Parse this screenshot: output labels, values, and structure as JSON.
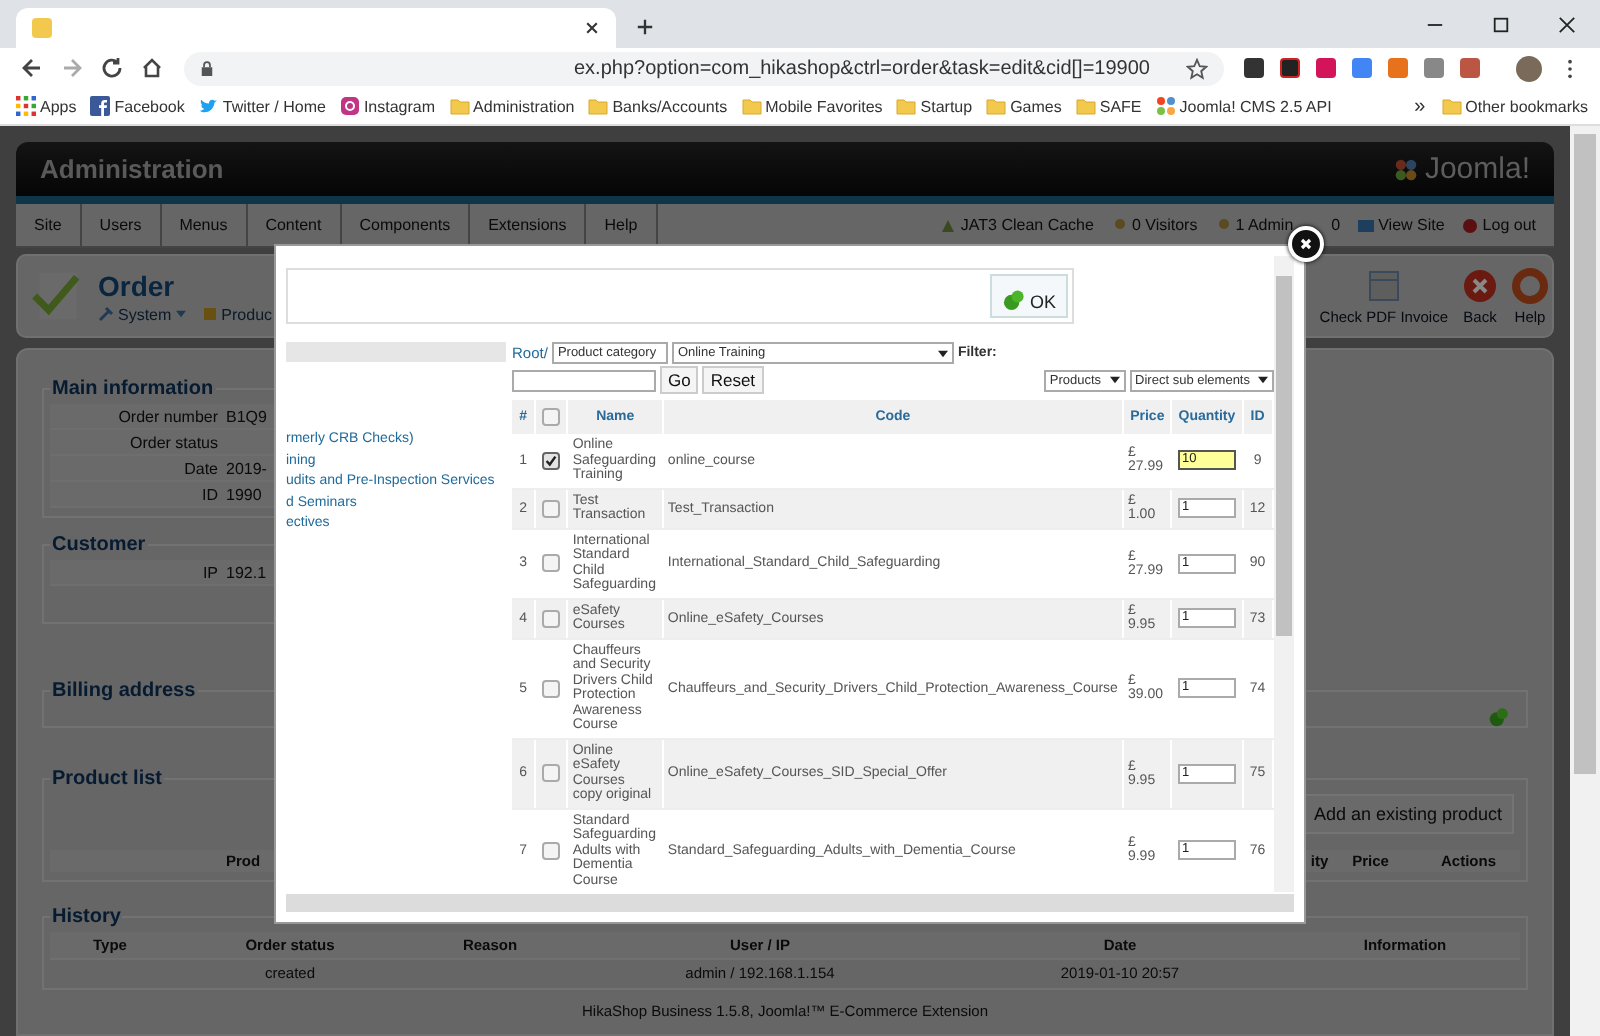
{
  "browser": {
    "url": "ex.php?option=com_hikashop&ctrl=order&task=edit&cid[]=19900",
    "bookmarks": [
      {
        "label": "Apps",
        "kind": "apps"
      },
      {
        "label": "Facebook",
        "kind": "facebook"
      },
      {
        "label": "Twitter / Home",
        "kind": "twitter"
      },
      {
        "label": "Instagram",
        "kind": "instagram"
      },
      {
        "label": "Administration",
        "kind": "folder"
      },
      {
        "label": "Banks/Accounts",
        "kind": "folder"
      },
      {
        "label": "Mobile Favorites",
        "kind": "folder"
      },
      {
        "label": "Startup",
        "kind": "folder"
      },
      {
        "label": "Games",
        "kind": "folder"
      },
      {
        "label": "SAFE",
        "kind": "folder"
      },
      {
        "label": "Joomla! CMS 2.5 API",
        "kind": "joomla"
      }
    ],
    "bookmarks_overflow": "»",
    "other_bookmarks": "Other bookmarks"
  },
  "admin": {
    "title": "Administration",
    "logo": "Joomla!",
    "menu": [
      "Site",
      "Users",
      "Menus",
      "Content",
      "Components",
      "Extensions",
      "Help"
    ],
    "status": [
      {
        "label": "JAT3 Clean Cache",
        "kind": "cache"
      },
      {
        "label": "0 Visitors",
        "kind": "users"
      },
      {
        "label": "1 Admin",
        "kind": "users"
      },
      {
        "label": "0",
        "kind": "mail"
      },
      {
        "label": "View Site",
        "kind": "site"
      },
      {
        "label": "Log out",
        "kind": "logout"
      }
    ]
  },
  "toolbar": {
    "title": "Order",
    "links": [
      {
        "label": "System",
        "kind": "system"
      },
      {
        "label": "Produc",
        "kind": "product"
      }
    ],
    "buttons": [
      {
        "label": "Check PDF Invoice",
        "kind": "pdf"
      },
      {
        "label": "Back",
        "kind": "back"
      },
      {
        "label": "Help",
        "kind": "help"
      }
    ]
  },
  "main_information": {
    "title": "Main information",
    "fields": [
      {
        "label": "Order number",
        "value": "B1Q9"
      },
      {
        "label": "Order status"
      },
      {
        "label": "Date",
        "value": "2019-"
      },
      {
        "label": "ID",
        "value": "1990"
      }
    ]
  },
  "customer": {
    "title": "Customer",
    "fields": [
      {
        "label": "IP",
        "value": "192.1"
      }
    ]
  },
  "billing_address": {
    "title": "Billing address"
  },
  "product_list": {
    "title": "Product list",
    "button": "Add an existing product",
    "columns": [
      "Prod",
      "ity",
      "Price",
      "Actions"
    ]
  },
  "history": {
    "title": "History",
    "columns": [
      "Type",
      "Order status",
      "Reason",
      "User / IP",
      "Date",
      "Information"
    ],
    "rows": [
      {
        "order_status": "created",
        "user_ip": "admin / 192.168.1.154",
        "date": "2019-01-10 20:57"
      }
    ]
  },
  "footer": "HikaShop Business 1.5.8, Joomla!™ E-Commerce Extension",
  "dialog": {
    "ok": "OK",
    "categories": [
      "rmerly CRB Checks)",
      "ining",
      "udits and Pre-Inspection Services",
      "d Seminars",
      "ectives"
    ],
    "filter": {
      "root": "Root/",
      "category_type": "Product category",
      "category": "Online Training",
      "label": "Filter:",
      "go": "Go",
      "reset": "Reset",
      "type": "Products",
      "scope": "Direct sub elements"
    },
    "columns": [
      "#",
      "Name",
      "Code",
      "Price",
      "Quantity",
      "ID"
    ],
    "all_checked": false,
    "rows": [
      {
        "num": "1",
        "checked": true,
        "name": "Online Safeguarding Training",
        "code": "online_course",
        "price": "£ 27.99",
        "quantity": "10",
        "focused": true,
        "id": "9"
      },
      {
        "num": "2",
        "checked": false,
        "name": "Test Transaction",
        "code": "Test_Transaction",
        "price": "£ 1.00",
        "quantity": "1",
        "focused": false,
        "id": "12"
      },
      {
        "num": "3",
        "checked": false,
        "name": "International Standard Child Safeguarding",
        "code": "International_Standard_Child_Safeguarding",
        "price": "£ 27.99",
        "quantity": "1",
        "focused": false,
        "id": "90"
      },
      {
        "num": "4",
        "checked": false,
        "name": "eSafety Courses",
        "code": "Online_eSafety_Courses",
        "price": "£ 9.95",
        "quantity": "1",
        "focused": false,
        "id": "73"
      },
      {
        "num": "5",
        "checked": false,
        "name": "Chauffeurs and Security Drivers Child Protection Awareness Course",
        "code": "Chauffeurs_and_Security_Drivers_Child_Protection_Awareness_Course",
        "price": "£ 39.00",
        "quantity": "1",
        "focused": false,
        "id": "74"
      },
      {
        "num": "6",
        "checked": false,
        "name": "Online eSafety Courses copy original",
        "code": "Online_eSafety_Courses_SID_Special_Offer",
        "price": "£ 9.95",
        "quantity": "1",
        "focused": false,
        "id": "75"
      },
      {
        "num": "7",
        "checked": false,
        "name": "Standard Safeguarding Adults with Dementia Course",
        "code": "Standard_Safeguarding_Adults_with_Dementia_Course",
        "price": "£ 9.99",
        "quantity": "1",
        "focused": false,
        "id": "76"
      }
    ]
  }
}
